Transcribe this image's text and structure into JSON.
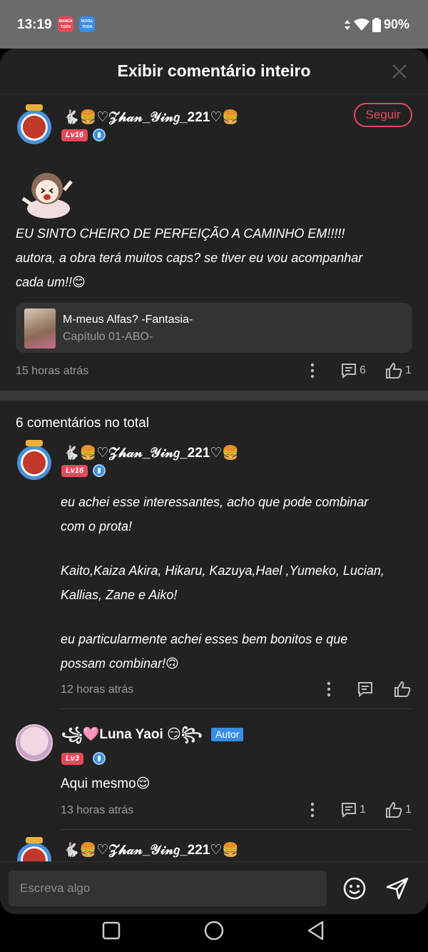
{
  "status_bar": {
    "time": "13:19",
    "app1": "MANGA TOON",
    "app2": "NOVEL TOON",
    "battery": "90%"
  },
  "header": {
    "title": "Exibir comentário inteiro"
  },
  "main_comment": {
    "username": "🐇🍔♡𝒵𝒽𝒶𝓃_𝒴𝒾𝓃𝑔_221♡🍔",
    "level": "Lv16",
    "follow_label": "Seguir",
    "text_line1": "EU SINTO CHEIRO DE PERFEIÇÃO A CAMINHO EM!!!!!",
    "text_line2": "autora, a obra terá muitos caps? se tiver eu vou acompanhar",
    "text_line3": "cada um!!😊",
    "book_title": "M-meus Alfas? -Fantasia-",
    "book_chapter": "Capítulo 01-ABO-",
    "timestamp": "15 horas atrás",
    "reply_count": "6",
    "like_count": "1"
  },
  "comments_total": "6 comentários no total",
  "replies": [
    {
      "username": "🐇🍔♡𝒵𝒽𝒶𝓃_𝒴𝒾𝓃𝑔_221♡🍔",
      "level": "Lv16",
      "lines": [
        "eu achei esse interessantes, acho que pode combinar",
        "com o prota!",
        "",
        "Kaito,Kaiza Akira, Hikaru, Kazuya,Hael ,Yumeko, Lucian,",
        "Kallias, Zane e Aiko!",
        "",
        "eu particularmente achei esses bem bonitos e que",
        "possam combinar!🙃"
      ],
      "timestamp": "12 horas atrás"
    },
    {
      "username": "꧁🩷Luna Yaoi 😏꧂",
      "badge": "Autor",
      "level": "Lv3",
      "text": "Aqui mesmo😌",
      "timestamp": "13 horas atrás",
      "reply_count": "1",
      "like_count": "1"
    },
    {
      "username": "🐇🍔♡𝒵𝒽𝒶𝓃_𝒴𝒾𝓃𝑔_221♡🍔"
    }
  ],
  "input": {
    "placeholder": "Escreva algo"
  },
  "colors": {
    "accent": "#e8485a",
    "blue": "#3a8ee8",
    "sheet_bg": "#222222"
  }
}
